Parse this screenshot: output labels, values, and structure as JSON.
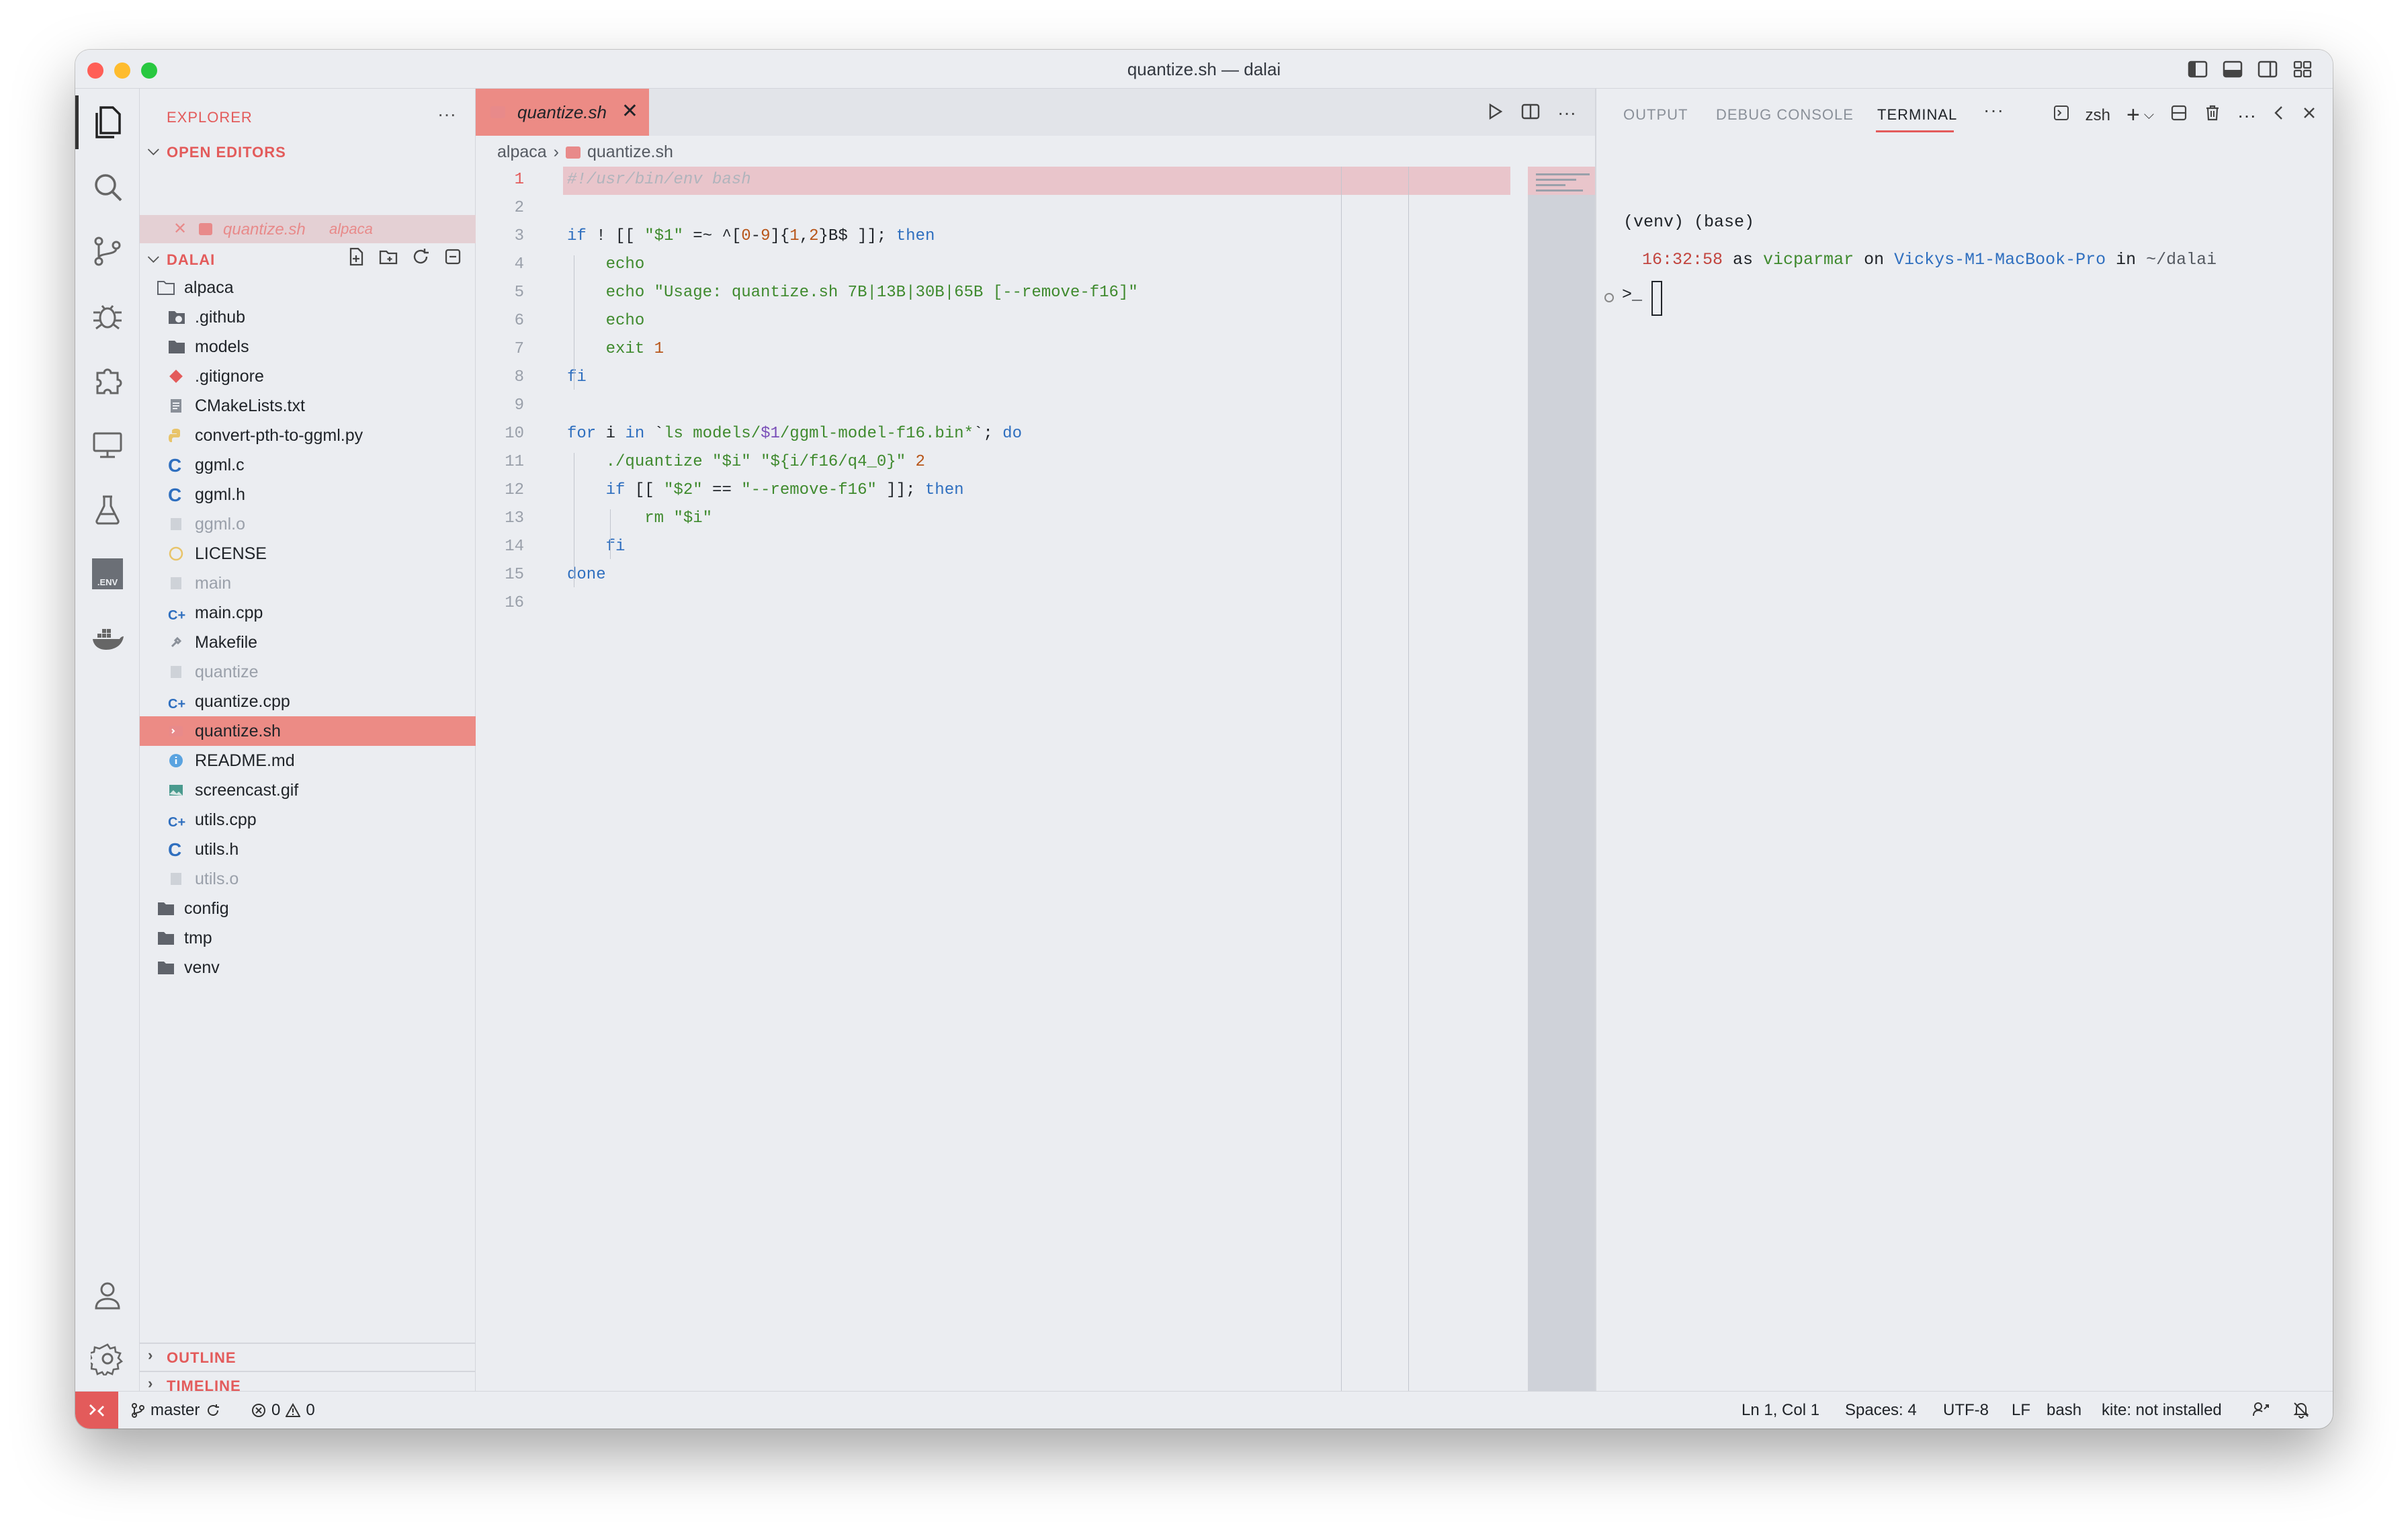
{
  "window": {
    "title": "quantize.sh — dalai"
  },
  "activity_bar": {
    "items": [
      "explorer-icon",
      "search-icon",
      "source-control-icon",
      "debug-icon",
      "extensions-icon",
      "remote-explorer-icon",
      "testing-icon",
      "dotenv-icon",
      "docker-icon"
    ],
    "env_label": ".ENV",
    "bottom": [
      "account-icon",
      "settings-gear-icon"
    ]
  },
  "sidebar": {
    "title": "EXPLORER",
    "open_editors_header": "OPEN EDITORS",
    "open_editor": {
      "name": "quantize.sh",
      "folder": "alpaca"
    },
    "workspace_header": "DALAI",
    "tree": [
      {
        "name": "alpaca",
        "icon": "folder-open",
        "depth": 0,
        "dim": false
      },
      {
        "name": ".github",
        "icon": "folder-github",
        "depth": 1,
        "dim": false
      },
      {
        "name": "models",
        "icon": "folder",
        "depth": 1,
        "dim": false
      },
      {
        "name": ".gitignore",
        "icon": "git",
        "depth": 1,
        "dim": false
      },
      {
        "name": "CMakeLists.txt",
        "icon": "text",
        "depth": 1,
        "dim": false
      },
      {
        "name": "convert-pth-to-ggml.py",
        "icon": "python",
        "depth": 1,
        "dim": false
      },
      {
        "name": "ggml.c",
        "icon": "c",
        "depth": 1,
        "dim": false
      },
      {
        "name": "ggml.h",
        "icon": "c",
        "depth": 1,
        "dim": false
      },
      {
        "name": "ggml.o",
        "icon": "binary",
        "depth": 1,
        "dim": true
      },
      {
        "name": "LICENSE",
        "icon": "license",
        "depth": 1,
        "dim": false
      },
      {
        "name": "main",
        "icon": "binary",
        "depth": 1,
        "dim": true
      },
      {
        "name": "main.cpp",
        "icon": "cpp",
        "depth": 1,
        "dim": false
      },
      {
        "name": "Makefile",
        "icon": "makefile",
        "depth": 1,
        "dim": false
      },
      {
        "name": "quantize",
        "icon": "binary",
        "depth": 1,
        "dim": true
      },
      {
        "name": "quantize.cpp",
        "icon": "cpp",
        "depth": 1,
        "dim": false
      },
      {
        "name": "quantize.sh",
        "icon": "shell",
        "depth": 1,
        "dim": false,
        "selected": true
      },
      {
        "name": "README.md",
        "icon": "info",
        "depth": 1,
        "dim": false
      },
      {
        "name": "screencast.gif",
        "icon": "image",
        "depth": 1,
        "dim": false
      },
      {
        "name": "utils.cpp",
        "icon": "cpp",
        "depth": 1,
        "dim": false
      },
      {
        "name": "utils.h",
        "icon": "c",
        "depth": 1,
        "dim": false
      },
      {
        "name": "utils.o",
        "icon": "binary",
        "depth": 1,
        "dim": true
      },
      {
        "name": "config",
        "icon": "folder",
        "depth": 0,
        "dim": false
      },
      {
        "name": "tmp",
        "icon": "folder",
        "depth": 0,
        "dim": false
      },
      {
        "name": "venv",
        "icon": "folder",
        "depth": 0,
        "dim": false
      }
    ],
    "outline_header": "OUTLINE",
    "timeline_header": "TIMELINE"
  },
  "editor": {
    "tab": {
      "label": "quantize.sh"
    },
    "breadcrumb": {
      "folder": "alpaca",
      "file": "quantize.sh"
    },
    "lines": [
      {
        "n": "1",
        "tokens": [
          [
            "#!/usr/bin/env bash",
            "cm"
          ]
        ]
      },
      {
        "n": "2",
        "tokens": []
      },
      {
        "n": "3",
        "tokens": [
          [
            "if",
            "kw"
          ],
          [
            " ! [[ ",
            ""
          ],
          [
            "\"$1\"",
            "green"
          ],
          [
            " =~ ^[",
            ""
          ],
          [
            "0",
            "num"
          ],
          [
            "-",
            ""
          ],
          [
            "9",
            "num"
          ],
          [
            "]{",
            ""
          ],
          [
            "1",
            "num"
          ],
          [
            ",",
            ""
          ],
          [
            "2",
            "num"
          ],
          [
            "}B$ ]]; ",
            ""
          ],
          [
            "then",
            "kw"
          ]
        ]
      },
      {
        "n": "4",
        "tokens": [
          [
            "    ",
            ""
          ],
          [
            "echo",
            "green"
          ]
        ]
      },
      {
        "n": "5",
        "tokens": [
          [
            "    ",
            ""
          ],
          [
            "echo",
            "green"
          ],
          [
            " ",
            ""
          ],
          [
            "\"Usage: quantize.sh 7B|13B|30B|65B [--remove-f16]\"",
            "green"
          ]
        ]
      },
      {
        "n": "6",
        "tokens": [
          [
            "    ",
            ""
          ],
          [
            "echo",
            "green"
          ]
        ]
      },
      {
        "n": "7",
        "tokens": [
          [
            "    ",
            ""
          ],
          [
            "exit",
            "green"
          ],
          [
            " ",
            ""
          ],
          [
            "1",
            "num"
          ]
        ]
      },
      {
        "n": "8",
        "tokens": [
          [
            "fi",
            "kw"
          ]
        ]
      },
      {
        "n": "9",
        "tokens": []
      },
      {
        "n": "10",
        "tokens": [
          [
            "for",
            "kw"
          ],
          [
            " i ",
            ""
          ],
          [
            "in",
            "kw"
          ],
          [
            " `",
            ""
          ],
          [
            "ls",
            "green"
          ],
          [
            " models/",
            "green"
          ],
          [
            "$1",
            "purple"
          ],
          [
            "/ggml-model-f16.bin*",
            "green"
          ],
          [
            "`; ",
            ""
          ],
          [
            "do",
            "kw"
          ]
        ]
      },
      {
        "n": "11",
        "tokens": [
          [
            "    ",
            ""
          ],
          [
            "./quantize",
            "green"
          ],
          [
            " ",
            ""
          ],
          [
            "\"$i\"",
            "green"
          ],
          [
            " ",
            ""
          ],
          [
            "\"${i/f16/q4_0}\"",
            "green"
          ],
          [
            " ",
            ""
          ],
          [
            "2",
            "num"
          ]
        ]
      },
      {
        "n": "12",
        "tokens": [
          [
            "    ",
            ""
          ],
          [
            "if",
            "kw"
          ],
          [
            " [[ ",
            ""
          ],
          [
            "\"$2\"",
            "green"
          ],
          [
            " == ",
            ""
          ],
          [
            "\"--remove-f16\"",
            "green"
          ],
          [
            " ]]; ",
            ""
          ],
          [
            "then",
            "kw"
          ]
        ]
      },
      {
        "n": "13",
        "tokens": [
          [
            "        ",
            ""
          ],
          [
            "rm",
            "green"
          ],
          [
            " ",
            ""
          ],
          [
            "\"$i\"",
            "green"
          ]
        ]
      },
      {
        "n": "14",
        "tokens": [
          [
            "    ",
            ""
          ],
          [
            "fi",
            "kw"
          ]
        ]
      },
      {
        "n": "15",
        "tokens": [
          [
            "done",
            "kw"
          ]
        ]
      },
      {
        "n": "16",
        "tokens": []
      }
    ]
  },
  "panel": {
    "tabs": [
      "OUTPUT",
      "DEBUG CONSOLE",
      "TERMINAL"
    ],
    "active_tab": "TERMINAL",
    "more": "···",
    "shell": "zsh",
    "terminal": {
      "line1": "(venv) (base)",
      "time": "16:32:58",
      "as": " as ",
      "user": "vicparmar",
      "on": " on ",
      "host": "Vickys-M1-MacBook-Pro",
      "in": " in ",
      "path": "~/dalai",
      "prompt": ">_"
    }
  },
  "statusbar": {
    "branch": "master",
    "errors": "0",
    "warnings": "0",
    "cursor": "Ln 1, Col 1",
    "spaces": "Spaces: 4",
    "encoding": "UTF-8",
    "eol": "LF",
    "language": "bash",
    "kite": "kite: not installed"
  },
  "colors": {
    "accent": "#e35b5b",
    "selection": "#ec8b85",
    "line_highlight": "#e9c5cb",
    "background": "#ebedf1"
  }
}
